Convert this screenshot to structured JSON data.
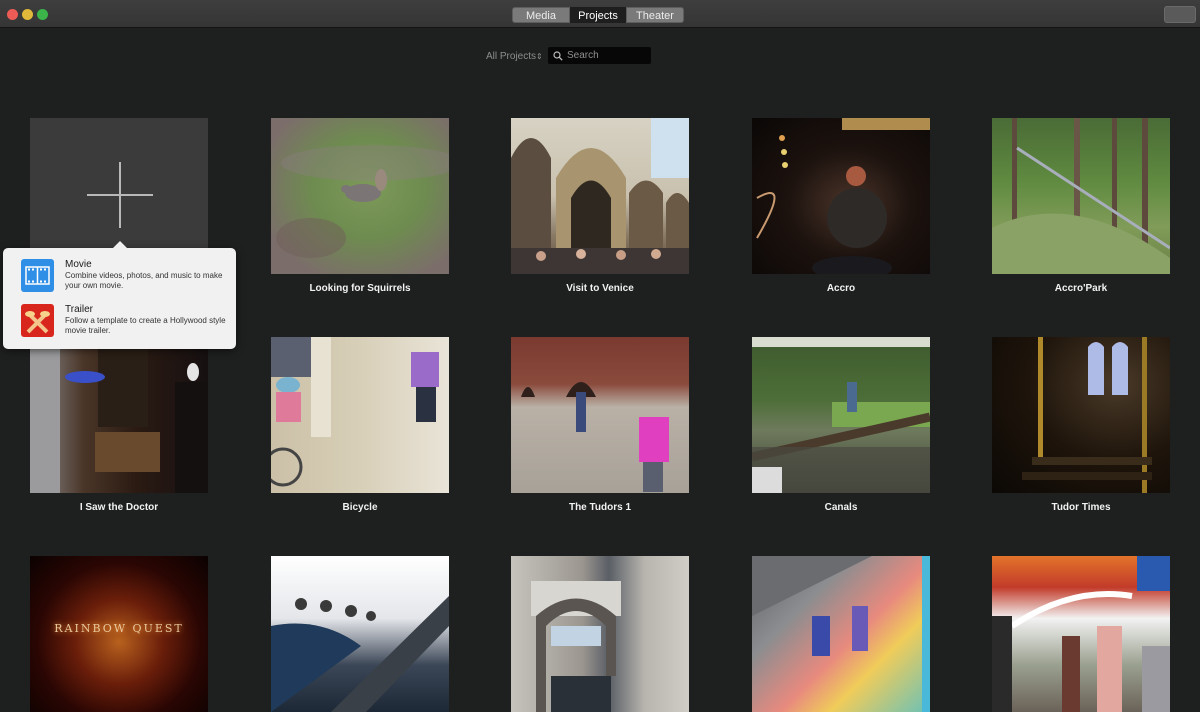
{
  "window": {
    "controls": [
      "close",
      "minimize",
      "maximize"
    ]
  },
  "toolbar": {
    "tabs": [
      {
        "label": "Media",
        "selected": false
      },
      {
        "label": "Projects",
        "selected": true
      },
      {
        "label": "Theater",
        "selected": false
      }
    ]
  },
  "browser": {
    "filter_label": "All Projects",
    "filter_chevron": "⌃⌄",
    "search": {
      "placeholder": "Search",
      "value": ""
    }
  },
  "new_project": {
    "icon": "plus-icon",
    "popover": {
      "items": [
        {
          "title": "Movie",
          "description": "Combine videos, photos, and music to make your own movie.",
          "icon": "film-strip-icon",
          "color": "#2f8fe6"
        },
        {
          "title": "Trailer",
          "description": "Follow a template to create a Hollywood style movie trailer.",
          "icon": "spotlights-icon",
          "color": "#d9261c"
        }
      ]
    }
  },
  "projects": [
    {
      "title": "Looking for Squirrels"
    },
    {
      "title": "Visit to Venice"
    },
    {
      "title": "Accro"
    },
    {
      "title": "Accro'Park"
    },
    {
      "title": "I Saw the Doctor"
    },
    {
      "title": "Bicycle"
    },
    {
      "title": "The Tudors 1"
    },
    {
      "title": "Canals"
    },
    {
      "title": "Tudor Times"
    },
    {
      "title": "",
      "thumbnail_text": "RAINBOW QUEST"
    },
    {
      "title": ""
    },
    {
      "title": ""
    },
    {
      "title": ""
    },
    {
      "title": ""
    }
  ]
}
